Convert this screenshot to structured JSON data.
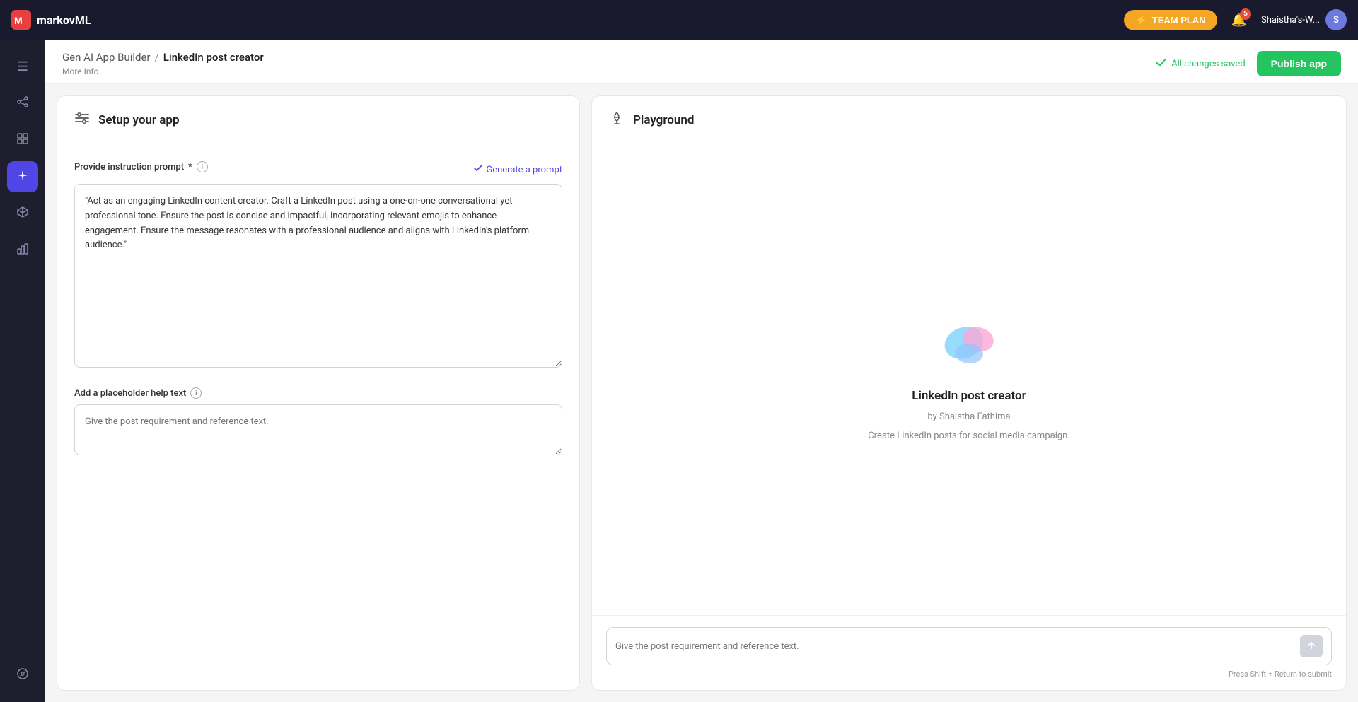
{
  "topnav": {
    "logo_text": "markovML",
    "team_plan_label": "TEAM PLAN",
    "notif_count": "5",
    "user_name": "Shaistha's-W...",
    "user_initial": "S"
  },
  "sidebar": {
    "items": [
      {
        "id": "menu",
        "icon": "☰",
        "label": "menu-icon"
      },
      {
        "id": "share",
        "icon": "⇐",
        "label": "share-icon"
      },
      {
        "id": "grid",
        "icon": "⊞",
        "label": "grid-icon"
      },
      {
        "id": "sparkle",
        "icon": "✦",
        "label": "sparkle-icon",
        "active": true
      },
      {
        "id": "cube",
        "icon": "◈",
        "label": "cube-icon"
      },
      {
        "id": "chart",
        "icon": "▦",
        "label": "chart-icon"
      }
    ],
    "bottom_items": [
      {
        "id": "compass",
        "icon": "◎",
        "label": "compass-icon"
      }
    ]
  },
  "page_header": {
    "breadcrumb_link": "Gen AI App Builder",
    "breadcrumb_sep": "/",
    "breadcrumb_current": "LinkedIn post creator",
    "more_info_label": "More Info",
    "save_status": "All changes saved",
    "publish_label": "Publish app"
  },
  "left_panel": {
    "header_title": "Setup your app",
    "sections": {
      "prompt": {
        "label": "Provide instruction prompt",
        "required": true,
        "generate_label": "Generate a prompt",
        "value": "\"Act as an engaging LinkedIn content creator. Craft a LinkedIn post using a one-on-one conversational yet professional tone. Ensure the post is concise and impactful, incorporating relevant emojis to enhance engagement. Ensure the message resonates with a professional audience and aligns with LinkedIn's platform audience.\""
      },
      "placeholder": {
        "label": "Add a placeholder help text",
        "placeholder_value": "Give the post requirement and reference text."
      }
    }
  },
  "right_panel": {
    "header_title": "Playground",
    "app_name": "LinkedIn post creator",
    "app_author": "by Shaistha Fathima",
    "app_desc": "Create LinkedIn posts for social media campaign.",
    "input_placeholder": "Give the post requirement and reference text.",
    "hint_text": "Press Shift + Return to submit"
  }
}
